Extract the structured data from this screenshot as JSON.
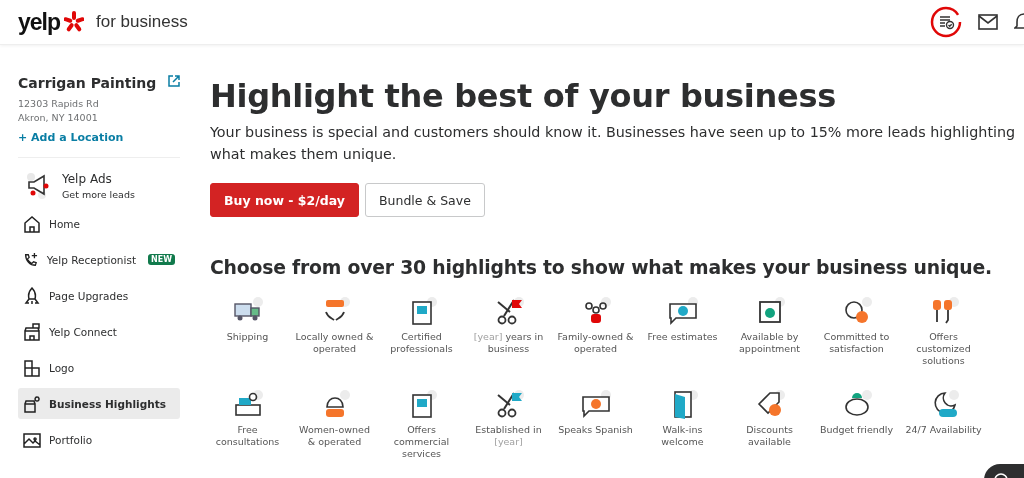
{
  "header": {
    "logo": "yelp",
    "logo_suffix": "for business"
  },
  "business": {
    "name": "Carrigan Painting",
    "address_lines": [
      "12303 Rapids Rd",
      "Akron, NY 14001"
    ],
    "add_location": "+ Add a Location"
  },
  "promo": {
    "title": "Yelp Ads",
    "subtitle": "Get more leads"
  },
  "nav": [
    {
      "label": "Home",
      "selected": false
    },
    {
      "label": "Yelp Receptionist",
      "badge": "NEW",
      "selected": false
    },
    {
      "label": "Page Upgrades",
      "selected": false
    },
    {
      "label": "Yelp Connect",
      "selected": false
    },
    {
      "label": "Logo",
      "selected": false
    },
    {
      "label": "Business Highlights",
      "selected": true
    },
    {
      "label": "Portfolio",
      "selected": false
    }
  ],
  "hero": {
    "title": "Highlight the best of your business",
    "text": "Your business is special and customers should know it. Businesses have seen up to 15% more leads highlighting what makes them unique.",
    "buttons": [
      {
        "label": "Buy now - $2/day",
        "kind": "primary"
      },
      {
        "label": "Bundle & Save",
        "kind": "secondary"
      }
    ]
  },
  "highlights_heading": "Choose from over 30 highlights to show what makes your business unique.",
  "highlights": [
    [
      {
        "text": "Shipping",
        "muted": false
      }
    ],
    [
      {
        "text": "Locally owned & operated",
        "muted": false
      }
    ],
    [
      {
        "text": "Certified professionals",
        "muted": false
      }
    ],
    [
      {
        "text": "[year]",
        "muted": true
      },
      {
        "text": " years in business",
        "muted": false
      }
    ],
    [
      {
        "text": "Family-owned & operated",
        "muted": false
      }
    ],
    [
      {
        "text": "Free estimates",
        "muted": false
      }
    ],
    [
      {
        "text": "Available by appointment",
        "muted": false
      }
    ],
    [
      {
        "text": "Committed to satisfaction",
        "muted": false
      }
    ],
    [
      {
        "text": "Offers customized solutions",
        "muted": false
      }
    ],
    [
      {
        "text": "Free consultations",
        "muted": false
      }
    ],
    [
      {
        "text": "Women-owned & operated",
        "muted": false
      }
    ],
    [
      {
        "text": "Offers commercial services",
        "muted": false
      }
    ],
    [
      {
        "text": "Established in ",
        "muted": false
      },
      {
        "text": "[year]",
        "muted": true
      }
    ],
    [
      {
        "text": "Speaks Spanish",
        "muted": false
      }
    ],
    [
      {
        "text": "Walk-ins welcome",
        "muted": false
      }
    ],
    [
      {
        "text": "Discounts available",
        "muted": false
      }
    ],
    [
      {
        "text": "Budget friendly",
        "muted": false
      }
    ],
    [
      {
        "text": "24/7 Availability",
        "muted": false
      }
    ]
  ]
}
